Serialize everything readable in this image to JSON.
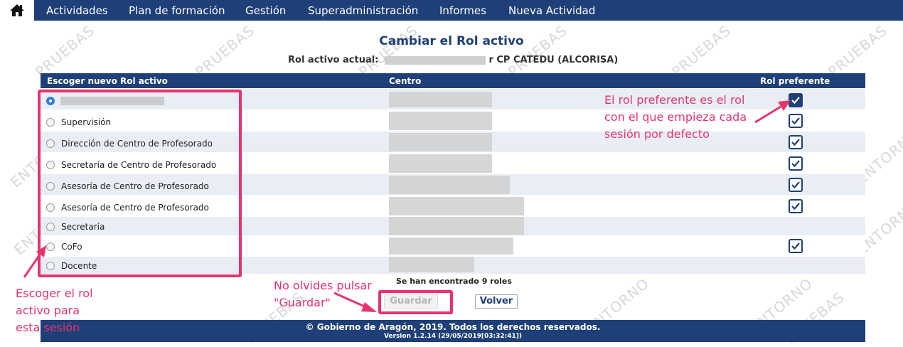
{
  "nav": {
    "home_icon": "home-icon",
    "items": [
      "Actividades",
      "Plan de formación",
      "Gestión",
      "Superadministración",
      "Informes",
      "Nueva Actividad"
    ]
  },
  "watermark": {
    "text1": "PRUEBAS",
    "text2": "ENTORNO",
    "text3": "PRUEBAS"
  },
  "page": {
    "title": "Cambiar el Rol activo",
    "current_label": "Rol activo actual:",
    "current_value": "r CP CATEDU (ALCORISA)"
  },
  "table": {
    "headers": {
      "role": "Escoger nuevo Rol activo",
      "center": "Centro",
      "preferred": "Rol preferente"
    },
    "rows": [
      {
        "label": "",
        "selected": true,
        "preferred": true
      },
      {
        "label": "Supervisión",
        "selected": false,
        "preferred": true
      },
      {
        "label": "Dirección de Centro de Profesorado",
        "selected": false,
        "preferred": true
      },
      {
        "label": "Secretaría de Centro de Profesorado",
        "selected": false,
        "preferred": true
      },
      {
        "label": "Asesoría de Centro de Profesorado",
        "selected": false,
        "preferred": true
      },
      {
        "label": "Asesoría de Centro de Profesorado",
        "selected": false,
        "preferred": true
      },
      {
        "label": "Secretaría",
        "selected": false,
        "preferred": false
      },
      {
        "label": "CoFo",
        "selected": false,
        "preferred": true
      },
      {
        "label": "Docente",
        "selected": false,
        "preferred": false
      }
    ],
    "found_text": "Se han encontrado 9 roles"
  },
  "buttons": {
    "save": "Guardar",
    "back": "Volver"
  },
  "footer": {
    "copyright": "© Gobierno de Aragón, 2019. Todos los derechos reservados.",
    "version": "Version 1.2.14 (29/05/2019[03:32:41])"
  },
  "annotations": {
    "preferred_note_lines": [
      "El rol preferente es el rol",
      "con el que empieza cada",
      "sesión por defecto"
    ],
    "choose_note_lines": [
      "Escoger el rol",
      "activo para",
      "esta sesión"
    ],
    "save_note_lines": [
      "No olvides pulsar",
      "\"Guardar\""
    ]
  },
  "colors": {
    "brand": "#1e3f78",
    "annotation": "#e8336d",
    "row_alt": "#e9eef5"
  }
}
